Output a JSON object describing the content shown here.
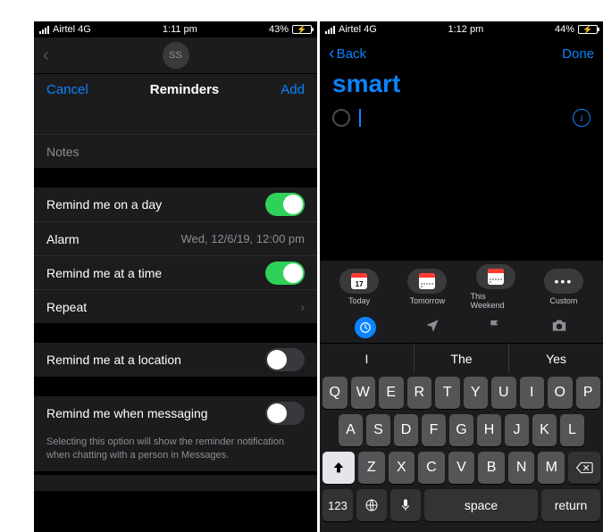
{
  "left": {
    "status": {
      "carrier": "Airtel 4G",
      "time": "1:11 pm",
      "battery_pct": "43%",
      "battery_fill": 43
    },
    "avatar": "SS",
    "nav": {
      "cancel": "Cancel",
      "title": "Reminders",
      "add": "Add"
    },
    "notes_placeholder": "Notes",
    "rows": {
      "remind_day": {
        "label": "Remind me on a day",
        "on": true
      },
      "alarm": {
        "label": "Alarm",
        "value": "Wed, 12/6/19, 12:00 pm"
      },
      "remind_time": {
        "label": "Remind me at a time",
        "on": true
      },
      "repeat": {
        "label": "Repeat"
      },
      "remind_loc": {
        "label": "Remind me at a location",
        "on": false
      },
      "remind_msg": {
        "label": "Remind me when messaging",
        "on": false
      }
    },
    "msg_footer": "Selecting this option will show the reminder notification when chatting with a person in Messages."
  },
  "right": {
    "status": {
      "carrier": "Airtel 4G",
      "time": "1:12 pm",
      "battery_pct": "44%",
      "battery_fill": 44
    },
    "nav": {
      "back": "Back",
      "done": "Done"
    },
    "list_name": "smart",
    "quick": {
      "today": {
        "label": "Today",
        "date": "17"
      },
      "tomorrow": {
        "label": "Tomorrow"
      },
      "weekend": {
        "label": "This Weekend"
      },
      "custom": {
        "label": "Custom"
      }
    },
    "suggestions": [
      "I",
      "The",
      "Yes"
    ],
    "keys": {
      "r1": [
        "Q",
        "W",
        "E",
        "R",
        "T",
        "Y",
        "U",
        "I",
        "O",
        "P"
      ],
      "r2": [
        "A",
        "S",
        "D",
        "F",
        "G",
        "H",
        "J",
        "K",
        "L"
      ],
      "r3": [
        "Z",
        "X",
        "C",
        "V",
        "B",
        "N",
        "M"
      ],
      "num": "123",
      "space": "space",
      "return": "return"
    }
  }
}
